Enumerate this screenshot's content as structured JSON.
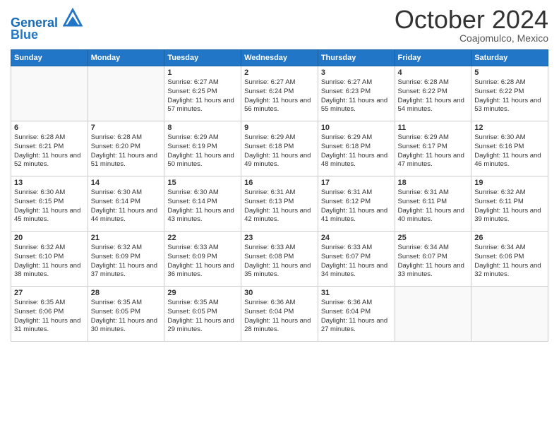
{
  "header": {
    "logo_line1": "General",
    "logo_line2": "Blue",
    "month": "October 2024",
    "location": "Coajomulco, Mexico"
  },
  "days_of_week": [
    "Sunday",
    "Monday",
    "Tuesday",
    "Wednesday",
    "Thursday",
    "Friday",
    "Saturday"
  ],
  "weeks": [
    [
      {
        "day": "",
        "sunrise": "",
        "sunset": "",
        "daylight": ""
      },
      {
        "day": "",
        "sunrise": "",
        "sunset": "",
        "daylight": ""
      },
      {
        "day": "1",
        "sunrise": "Sunrise: 6:27 AM",
        "sunset": "Sunset: 6:25 PM",
        "daylight": "Daylight: 11 hours and 57 minutes."
      },
      {
        "day": "2",
        "sunrise": "Sunrise: 6:27 AM",
        "sunset": "Sunset: 6:24 PM",
        "daylight": "Daylight: 11 hours and 56 minutes."
      },
      {
        "day": "3",
        "sunrise": "Sunrise: 6:27 AM",
        "sunset": "Sunset: 6:23 PM",
        "daylight": "Daylight: 11 hours and 55 minutes."
      },
      {
        "day": "4",
        "sunrise": "Sunrise: 6:28 AM",
        "sunset": "Sunset: 6:22 PM",
        "daylight": "Daylight: 11 hours and 54 minutes."
      },
      {
        "day": "5",
        "sunrise": "Sunrise: 6:28 AM",
        "sunset": "Sunset: 6:22 PM",
        "daylight": "Daylight: 11 hours and 53 minutes."
      }
    ],
    [
      {
        "day": "6",
        "sunrise": "Sunrise: 6:28 AM",
        "sunset": "Sunset: 6:21 PM",
        "daylight": "Daylight: 11 hours and 52 minutes."
      },
      {
        "day": "7",
        "sunrise": "Sunrise: 6:28 AM",
        "sunset": "Sunset: 6:20 PM",
        "daylight": "Daylight: 11 hours and 51 minutes."
      },
      {
        "day": "8",
        "sunrise": "Sunrise: 6:29 AM",
        "sunset": "Sunset: 6:19 PM",
        "daylight": "Daylight: 11 hours and 50 minutes."
      },
      {
        "day": "9",
        "sunrise": "Sunrise: 6:29 AM",
        "sunset": "Sunset: 6:18 PM",
        "daylight": "Daylight: 11 hours and 49 minutes."
      },
      {
        "day": "10",
        "sunrise": "Sunrise: 6:29 AM",
        "sunset": "Sunset: 6:18 PM",
        "daylight": "Daylight: 11 hours and 48 minutes."
      },
      {
        "day": "11",
        "sunrise": "Sunrise: 6:29 AM",
        "sunset": "Sunset: 6:17 PM",
        "daylight": "Daylight: 11 hours and 47 minutes."
      },
      {
        "day": "12",
        "sunrise": "Sunrise: 6:30 AM",
        "sunset": "Sunset: 6:16 PM",
        "daylight": "Daylight: 11 hours and 46 minutes."
      }
    ],
    [
      {
        "day": "13",
        "sunrise": "Sunrise: 6:30 AM",
        "sunset": "Sunset: 6:15 PM",
        "daylight": "Daylight: 11 hours and 45 minutes."
      },
      {
        "day": "14",
        "sunrise": "Sunrise: 6:30 AM",
        "sunset": "Sunset: 6:14 PM",
        "daylight": "Daylight: 11 hours and 44 minutes."
      },
      {
        "day": "15",
        "sunrise": "Sunrise: 6:30 AM",
        "sunset": "Sunset: 6:14 PM",
        "daylight": "Daylight: 11 hours and 43 minutes."
      },
      {
        "day": "16",
        "sunrise": "Sunrise: 6:31 AM",
        "sunset": "Sunset: 6:13 PM",
        "daylight": "Daylight: 11 hours and 42 minutes."
      },
      {
        "day": "17",
        "sunrise": "Sunrise: 6:31 AM",
        "sunset": "Sunset: 6:12 PM",
        "daylight": "Daylight: 11 hours and 41 minutes."
      },
      {
        "day": "18",
        "sunrise": "Sunrise: 6:31 AM",
        "sunset": "Sunset: 6:11 PM",
        "daylight": "Daylight: 11 hours and 40 minutes."
      },
      {
        "day": "19",
        "sunrise": "Sunrise: 6:32 AM",
        "sunset": "Sunset: 6:11 PM",
        "daylight": "Daylight: 11 hours and 39 minutes."
      }
    ],
    [
      {
        "day": "20",
        "sunrise": "Sunrise: 6:32 AM",
        "sunset": "Sunset: 6:10 PM",
        "daylight": "Daylight: 11 hours and 38 minutes."
      },
      {
        "day": "21",
        "sunrise": "Sunrise: 6:32 AM",
        "sunset": "Sunset: 6:09 PM",
        "daylight": "Daylight: 11 hours and 37 minutes."
      },
      {
        "day": "22",
        "sunrise": "Sunrise: 6:33 AM",
        "sunset": "Sunset: 6:09 PM",
        "daylight": "Daylight: 11 hours and 36 minutes."
      },
      {
        "day": "23",
        "sunrise": "Sunrise: 6:33 AM",
        "sunset": "Sunset: 6:08 PM",
        "daylight": "Daylight: 11 hours and 35 minutes."
      },
      {
        "day": "24",
        "sunrise": "Sunrise: 6:33 AM",
        "sunset": "Sunset: 6:07 PM",
        "daylight": "Daylight: 11 hours and 34 minutes."
      },
      {
        "day": "25",
        "sunrise": "Sunrise: 6:34 AM",
        "sunset": "Sunset: 6:07 PM",
        "daylight": "Daylight: 11 hours and 33 minutes."
      },
      {
        "day": "26",
        "sunrise": "Sunrise: 6:34 AM",
        "sunset": "Sunset: 6:06 PM",
        "daylight": "Daylight: 11 hours and 32 minutes."
      }
    ],
    [
      {
        "day": "27",
        "sunrise": "Sunrise: 6:35 AM",
        "sunset": "Sunset: 6:06 PM",
        "daylight": "Daylight: 11 hours and 31 minutes."
      },
      {
        "day": "28",
        "sunrise": "Sunrise: 6:35 AM",
        "sunset": "Sunset: 6:05 PM",
        "daylight": "Daylight: 11 hours and 30 minutes."
      },
      {
        "day": "29",
        "sunrise": "Sunrise: 6:35 AM",
        "sunset": "Sunset: 6:05 PM",
        "daylight": "Daylight: 11 hours and 29 minutes."
      },
      {
        "day": "30",
        "sunrise": "Sunrise: 6:36 AM",
        "sunset": "Sunset: 6:04 PM",
        "daylight": "Daylight: 11 hours and 28 minutes."
      },
      {
        "day": "31",
        "sunrise": "Sunrise: 6:36 AM",
        "sunset": "Sunset: 6:04 PM",
        "daylight": "Daylight: 11 hours and 27 minutes."
      },
      {
        "day": "",
        "sunrise": "",
        "sunset": "",
        "daylight": ""
      },
      {
        "day": "",
        "sunrise": "",
        "sunset": "",
        "daylight": ""
      }
    ]
  ]
}
